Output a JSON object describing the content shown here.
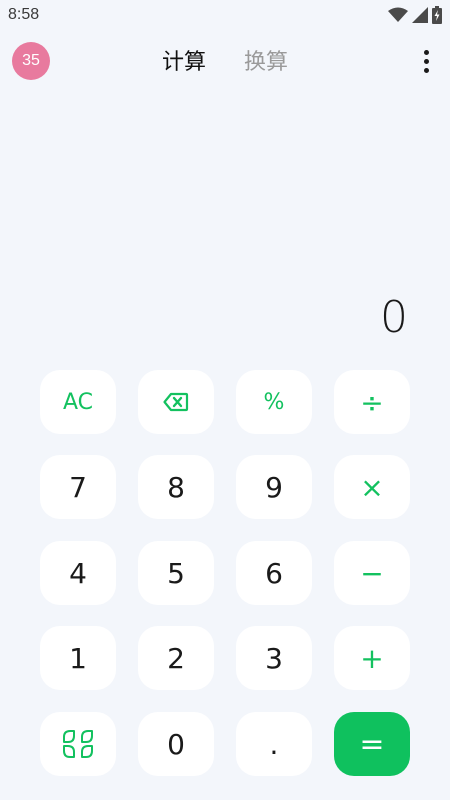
{
  "status_bar": {
    "time": "8:58",
    "icons": [
      "wifi-icon",
      "signal-icon",
      "battery-charging-icon"
    ]
  },
  "header": {
    "avatar_text": "35",
    "tabs": [
      {
        "label": "计算",
        "active": true
      },
      {
        "label": "换算",
        "active": false
      }
    ],
    "menu_icon": "more-vertical-icon"
  },
  "display": {
    "value": "0"
  },
  "keypad": {
    "rows": [
      [
        {
          "label": "AC",
          "kind": "func"
        },
        {
          "label": "",
          "kind": "func",
          "icon": "backspace-icon"
        },
        {
          "label": "%",
          "kind": "func"
        },
        {
          "label": "÷",
          "kind": "op"
        }
      ],
      [
        {
          "label": "7",
          "kind": "digit"
        },
        {
          "label": "8",
          "kind": "digit"
        },
        {
          "label": "9",
          "kind": "digit"
        },
        {
          "label": "×",
          "kind": "op"
        }
      ],
      [
        {
          "label": "4",
          "kind": "digit"
        },
        {
          "label": "5",
          "kind": "digit"
        },
        {
          "label": "6",
          "kind": "digit"
        },
        {
          "label": "−",
          "kind": "op"
        }
      ],
      [
        {
          "label": "1",
          "kind": "digit"
        },
        {
          "label": "2",
          "kind": "digit"
        },
        {
          "label": "3",
          "kind": "digit"
        },
        {
          "label": "+",
          "kind": "op"
        }
      ],
      [
        {
          "label": "",
          "kind": "func",
          "icon": "scientific-toggle-icon"
        },
        {
          "label": "0",
          "kind": "digit"
        },
        {
          "label": ".",
          "kind": "digit"
        },
        {
          "label": "=",
          "kind": "equals"
        }
      ]
    ]
  },
  "colors": {
    "background": "#f3f6fb",
    "accent": "#13c15f",
    "avatar": "#e87a9e",
    "key_background": "#ffffff"
  }
}
